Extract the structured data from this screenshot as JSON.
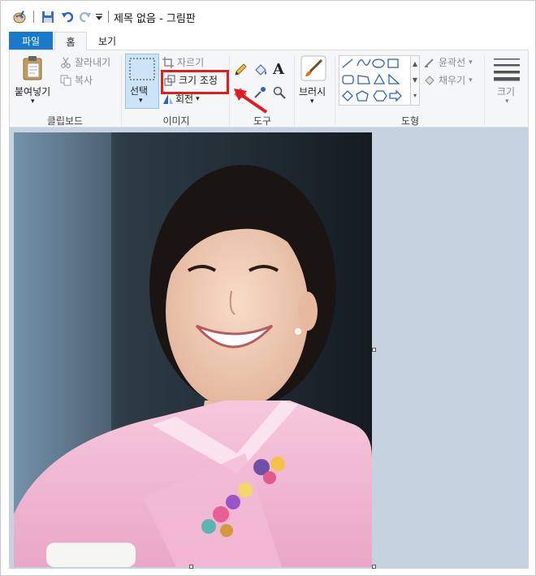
{
  "window": {
    "title": "제목 없음 - 그림판"
  },
  "tabs": {
    "file": "파일",
    "home": "홈",
    "view": "보기"
  },
  "clipboard": {
    "paste": "붙여넣기",
    "cut": "잘라내기",
    "copy": "복사",
    "label": "클립보드"
  },
  "image": {
    "select": "선택",
    "crop": "자르기",
    "resize": "크기 조정",
    "rotate": "회전",
    "label": "이미지"
  },
  "tools": {
    "label": "도구"
  },
  "brushes": {
    "label": "브러시"
  },
  "shapes": {
    "outline": "윤곽선",
    "fill": "채우기",
    "label": "도형"
  },
  "size": {
    "label": "크기"
  },
  "colors": {
    "tab_file": "#1979ca",
    "select_highlight": "#cce4f7",
    "annotation": "#e01c1c",
    "workspace": "#c7d2e0",
    "hanbok": "#f2b6d4"
  },
  "annotation": {
    "description": "red-box-and-arrow-highlighting-resize"
  }
}
